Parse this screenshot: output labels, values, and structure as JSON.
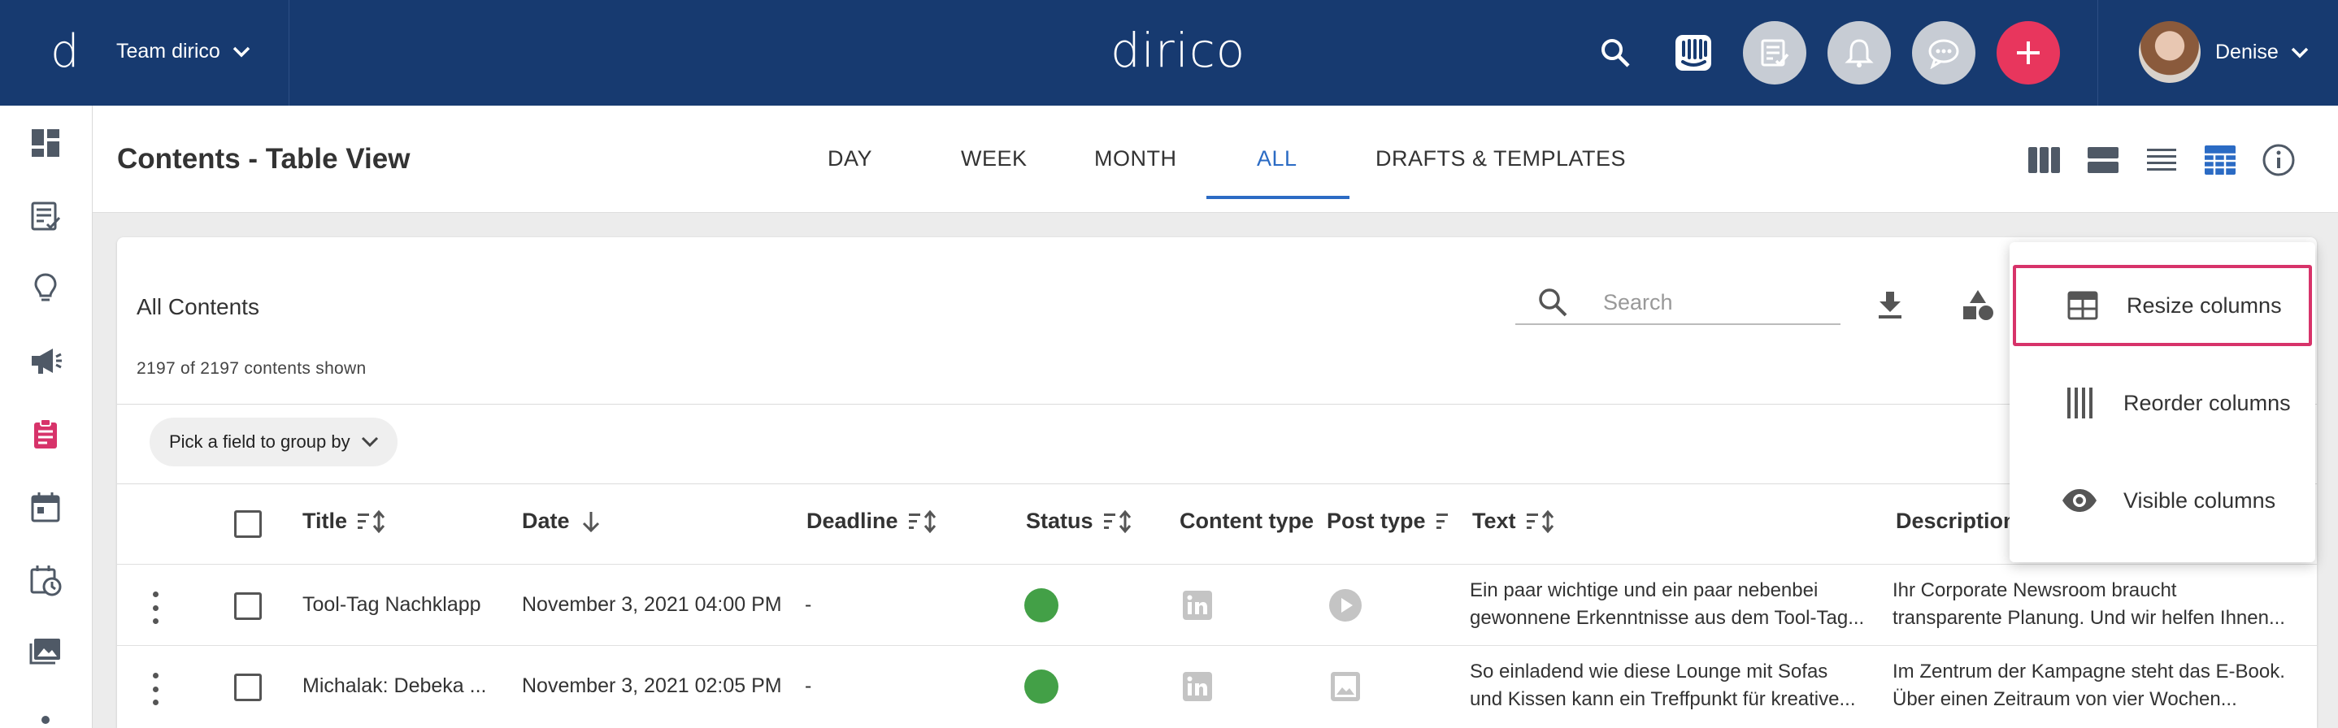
{
  "colors": {
    "topbar": "#173a70",
    "accent": "#2b6bc4",
    "add_button": "#e8365d",
    "status_green": "#43a047",
    "highlight_border": "#d7336a"
  },
  "topbar": {
    "logo_letter": "d",
    "team_label": "Team dirico",
    "brand": "dirico",
    "user_name": "Denise",
    "icons": [
      "search-icon",
      "intercom-icon",
      "tasks-icon",
      "bell-icon",
      "chat-icon",
      "plus-icon"
    ]
  },
  "sidebar": {
    "icons": [
      "dashboard-icon",
      "contents-icon",
      "idea-icon",
      "campaign-icon",
      "clipboard-icon",
      "calendar-icon",
      "schedule-icon",
      "media-icon",
      "more-icon"
    ]
  },
  "header": {
    "title": "Contents - Table View",
    "tabs": [
      {
        "label": "DAY",
        "active": false
      },
      {
        "label": "WEEK",
        "active": false
      },
      {
        "label": "MONTH",
        "active": false
      },
      {
        "label": "ALL",
        "active": true
      },
      {
        "label": "DRAFTS & TEMPLATES",
        "active": false
      }
    ],
    "view_icons": [
      "columns-view-icon",
      "cards-view-icon",
      "list-view-icon",
      "table-view-icon",
      "info-icon"
    ]
  },
  "card": {
    "title": "All Contents",
    "count_text": "2197 of 2197 contents shown",
    "search_placeholder": "Search",
    "group_chip": "Pick a field to group by"
  },
  "table": {
    "columns": [
      "Title",
      "Date",
      "Deadline",
      "Status",
      "Content type",
      "Post type",
      "Text",
      "Description"
    ],
    "rows": [
      {
        "title": "Tool-Tag Nachklapp",
        "date": "November 3, 2021 04:00 PM",
        "deadline": "-",
        "status": "green",
        "content_type": "linkedin-icon",
        "post_type": "video-icon",
        "text_1": "Ein paar wichtige und ein paar nebenbei",
        "text_2": "gewonnene Erkenntnisse aus dem Tool-Tag...",
        "desc_1": "Ihr Corporate Newsroom braucht",
        "desc_2": "transparente Planung. Und wir helfen Ihnen..."
      },
      {
        "title": "Michalak: Debeka ...",
        "date": "November 3, 2021 02:05 PM",
        "deadline": "-",
        "status": "green",
        "content_type": "linkedin-icon",
        "post_type": "image-icon",
        "text_1": "So einladend wie diese Lounge mit Sofas",
        "text_2": "und Kissen kann ein Treffpunkt für kreative...",
        "desc_1": "Im Zentrum der Kampagne steht das E-Book.",
        "desc_2": "Über einen Zeitraum von vier Wochen..."
      }
    ]
  },
  "menu": {
    "items": [
      {
        "label": "Resize columns",
        "icon": "resize-columns-icon",
        "highlighted": true
      },
      {
        "label": "Reorder columns",
        "icon": "reorder-columns-icon",
        "highlighted": false
      },
      {
        "label": "Visible columns",
        "icon": "eye-icon",
        "highlighted": false
      }
    ]
  }
}
